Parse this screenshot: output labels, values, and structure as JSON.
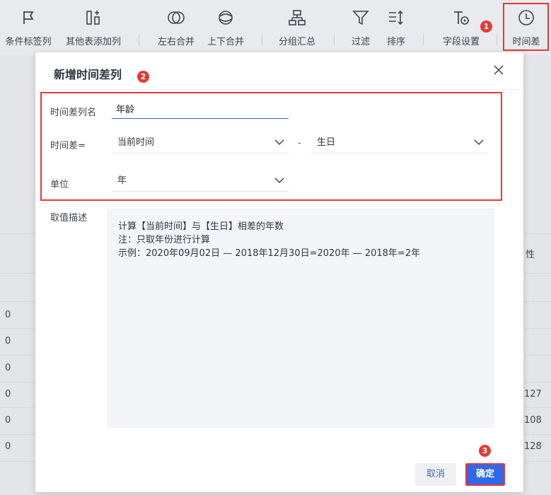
{
  "toolbar": {
    "items": [
      {
        "label": "条件标签列",
        "icon": "flag-icon"
      },
      {
        "label": "其他表添加列",
        "icon": "add-column-icon"
      },
      {
        "label": "左右合并",
        "icon": "merge-horizontal-icon"
      },
      {
        "label": "上下合并",
        "icon": "merge-vertical-icon"
      },
      {
        "label": "分组汇总",
        "icon": "group-summary-icon"
      },
      {
        "label": "过滤",
        "icon": "filter-icon"
      },
      {
        "label": "排序",
        "icon": "sort-icon"
      },
      {
        "label": "字段设置",
        "icon": "field-settings-icon"
      },
      {
        "label": "时间差",
        "icon": "clock-icon"
      }
    ],
    "annotation": "1"
  },
  "background": {
    "right_label": "性",
    "left_values": [
      "0",
      "0",
      "0",
      "0",
      "0",
      "0"
    ],
    "right_values": [
      "127",
      "108",
      "128"
    ]
  },
  "dialog": {
    "title": "新增时间差列",
    "title_annotation": "2",
    "fields": {
      "name_label": "时间差列名",
      "name_value": "年龄",
      "diff_label": "时间差=",
      "diff_left": "当前时间",
      "diff_separator": "-",
      "diff_right": "生日",
      "unit_label": "单位",
      "unit_value": "年"
    },
    "description": {
      "label": "取值描述",
      "lines": [
        "计算【当前时间】与【生日】相差的年数",
        "注：只取年份进行计算",
        "示例：2020年09月02日 — 2018年12月30日=2020年 — 2018年=2年"
      ]
    },
    "buttons": {
      "cancel": "取消",
      "ok": "确定",
      "ok_annotation": "3"
    }
  },
  "colors": {
    "highlight": "#e53935",
    "primary": "#2f68e8"
  }
}
